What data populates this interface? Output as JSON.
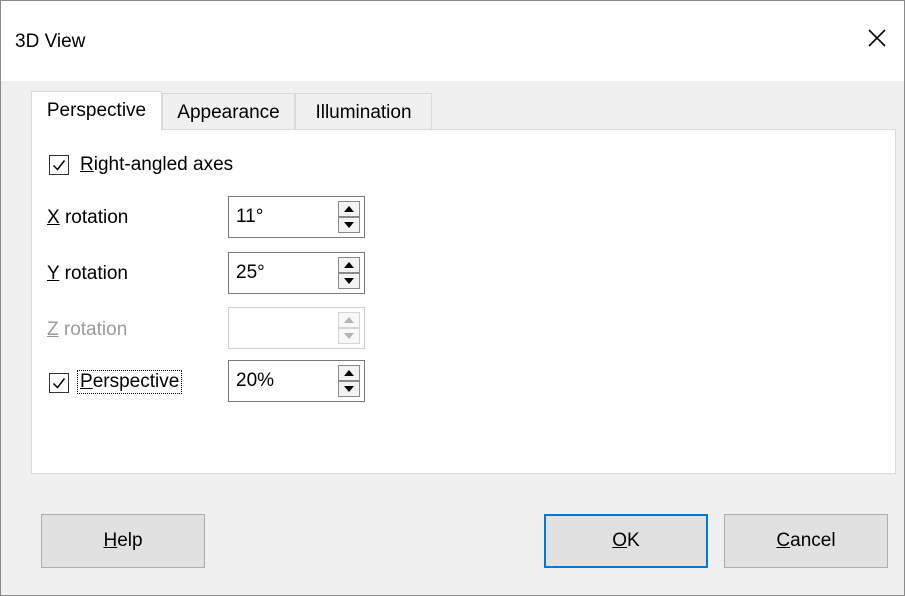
{
  "window": {
    "title": "3D View"
  },
  "tabs": [
    {
      "label": "Perspective",
      "active": true
    },
    {
      "label": "Appearance",
      "active": false
    },
    {
      "label": "Illumination",
      "active": false
    }
  ],
  "perspective_tab": {
    "right_angled_axes": {
      "mnemonic": "R",
      "rest": "ight-angled axes",
      "checked": true
    },
    "x_rotation": {
      "mnemonic": "X",
      "rest": " rotation",
      "value": "11°",
      "enabled": true
    },
    "y_rotation": {
      "mnemonic": "Y",
      "rest": " rotation",
      "value": "25°",
      "enabled": true
    },
    "z_rotation": {
      "mnemonic": "Z",
      "rest": " rotation",
      "value": "",
      "enabled": false
    },
    "perspective": {
      "mnemonic": "P",
      "rest": "erspective",
      "checked": true,
      "value": "20%"
    }
  },
  "buttons": {
    "help": {
      "mnemonic": "H",
      "rest": "elp"
    },
    "ok": {
      "mnemonic": "O",
      "rest": "K"
    },
    "cancel": {
      "mnemonic": "C",
      "rest": "ancel"
    }
  },
  "icons": {
    "close": "close-icon",
    "check": "check-icon",
    "spin_up": "triangle-up-icon",
    "spin_down": "triangle-down-icon"
  },
  "colors": {
    "accent": "#0078d7",
    "disabled_text": "#9a9a9a",
    "panel_bg": "#ffffff",
    "dialog_bg": "#f0f0f0"
  }
}
